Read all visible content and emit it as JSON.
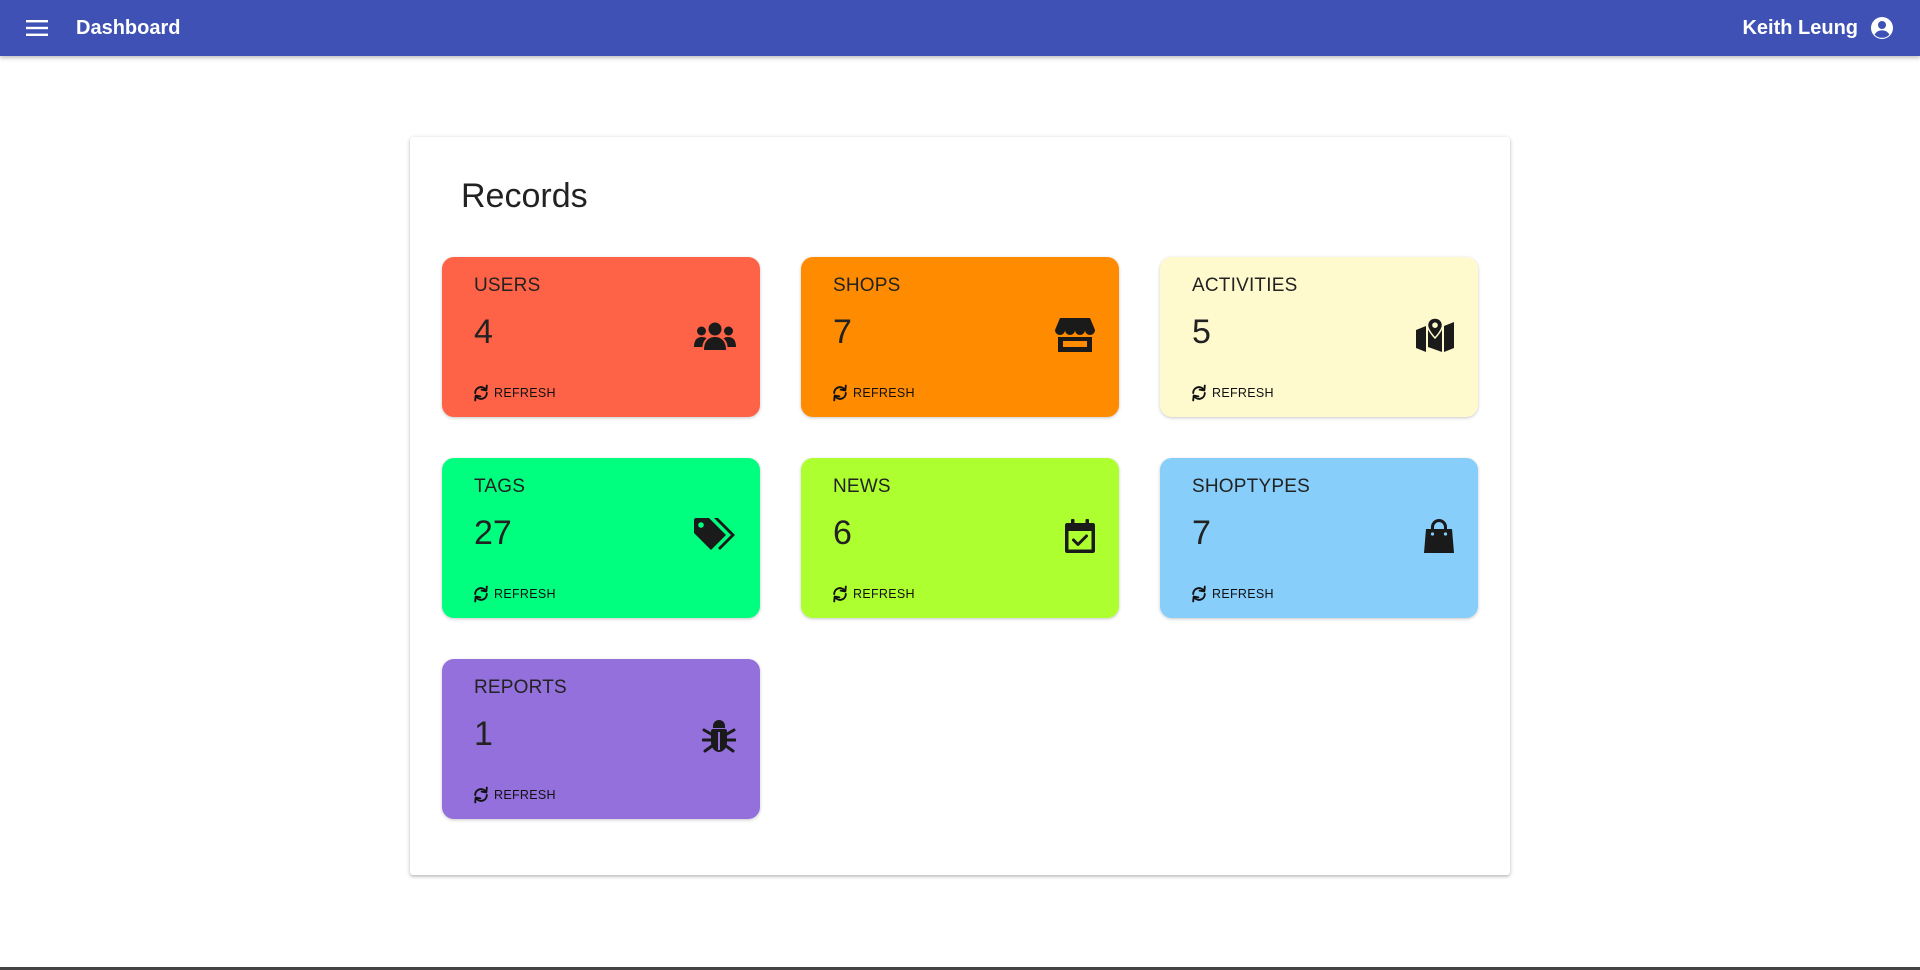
{
  "appbar": {
    "title": "Dashboard",
    "user_name": "Keith Leung",
    "color": "#3f51b5",
    "menu_icon": "menu-icon",
    "account_icon": "account-circle-icon"
  },
  "records": {
    "title": "Records",
    "cards": [
      {
        "label": "USERS",
        "value": "4",
        "refresh_label": "REFRESH",
        "color": "#ff6347",
        "icon": "users-icon"
      },
      {
        "label": "SHOPS",
        "value": "7",
        "refresh_label": "REFRESH",
        "color": "#ff8c00",
        "icon": "store-icon"
      },
      {
        "label": "ACTIVITIES",
        "value": "5",
        "refresh_label": "REFRESH",
        "color": "#fffacd",
        "icon": "map-marker-icon"
      },
      {
        "label": "TAGS",
        "value": "27",
        "refresh_label": "REFRESH",
        "color": "#00ff7f",
        "icon": "tags-icon"
      },
      {
        "label": "NEWS",
        "value": "6",
        "refresh_label": "REFRESH",
        "color": "#adff2f",
        "icon": "calendar-check-icon"
      },
      {
        "label": "SHOPTYPES",
        "value": "7",
        "refresh_label": "REFRESH",
        "color": "#87cefa",
        "icon": "shopping-bag-icon"
      },
      {
        "label": "REPORTS",
        "value": "1",
        "refresh_label": "REFRESH",
        "color": "#9370db",
        "icon": "bug-icon"
      }
    ]
  }
}
